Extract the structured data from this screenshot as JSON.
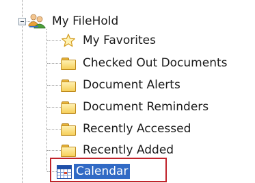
{
  "tree": {
    "root": {
      "label": "My FileHold",
      "icon": "users-icon",
      "expanded": true
    },
    "children": [
      {
        "label": "My Favorites",
        "icon": "star-icon"
      },
      {
        "label": "Checked Out Documents",
        "icon": "folder-icon"
      },
      {
        "label": "Document Alerts",
        "icon": "folder-icon"
      },
      {
        "label": "Document Reminders",
        "icon": "folder-icon"
      },
      {
        "label": "Recently Accessed",
        "icon": "folder-icon"
      },
      {
        "label": "Recently Added",
        "icon": "folder-icon"
      },
      {
        "label": "Calendar",
        "icon": "calendar-icon",
        "selected": true
      }
    ]
  },
  "colors": {
    "selection_background": "#316ac5",
    "highlight_frame": "#c0232b",
    "folder_fill": "#f6cf5a"
  }
}
